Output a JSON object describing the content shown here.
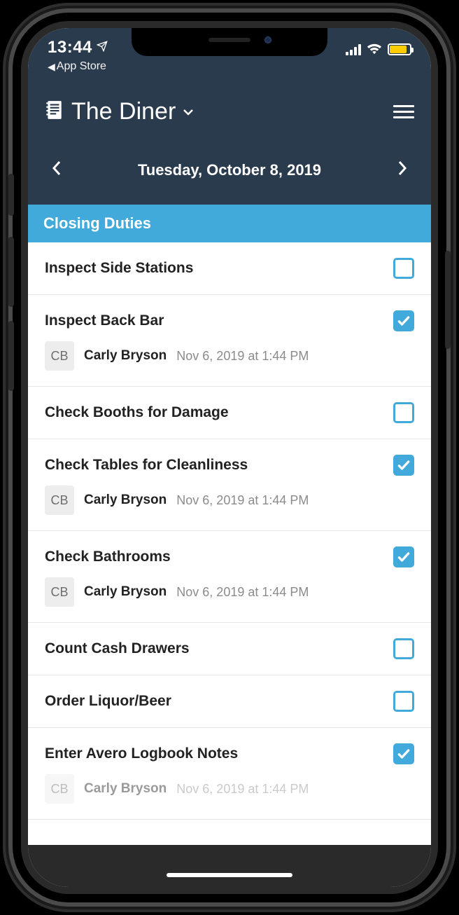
{
  "statusbar": {
    "time": "13:44",
    "back_app_label": "App Store"
  },
  "header": {
    "title": "The Diner"
  },
  "date_nav": {
    "date": "Tuesday, October 8, 2019"
  },
  "section": {
    "title": "Closing Duties"
  },
  "tasks": [
    {
      "title": "Inspect Side Stations",
      "checked": false
    },
    {
      "title": "Inspect Back Bar",
      "checked": true,
      "completed_by": {
        "initials": "CB",
        "name": "Carly Bryson",
        "time": "Nov 6, 2019 at 1:44 PM"
      }
    },
    {
      "title": "Check Booths for Damage",
      "checked": false
    },
    {
      "title": "Check Tables for Cleanliness",
      "checked": true,
      "completed_by": {
        "initials": "CB",
        "name": "Carly Bryson",
        "time": "Nov 6, 2019 at 1:44 PM"
      }
    },
    {
      "title": "Check Bathrooms",
      "checked": true,
      "completed_by": {
        "initials": "CB",
        "name": "Carly Bryson",
        "time": "Nov 6, 2019 at 1:44 PM"
      }
    },
    {
      "title": "Count Cash Drawers",
      "checked": false
    },
    {
      "title": "Order Liquor/Beer",
      "checked": false
    },
    {
      "title": "Enter Avero Logbook Notes",
      "checked": true,
      "completed_by": {
        "initials": "CB",
        "name": "Carly Bryson",
        "time": "Nov 6, 2019 at 1:44 PM"
      }
    }
  ]
}
